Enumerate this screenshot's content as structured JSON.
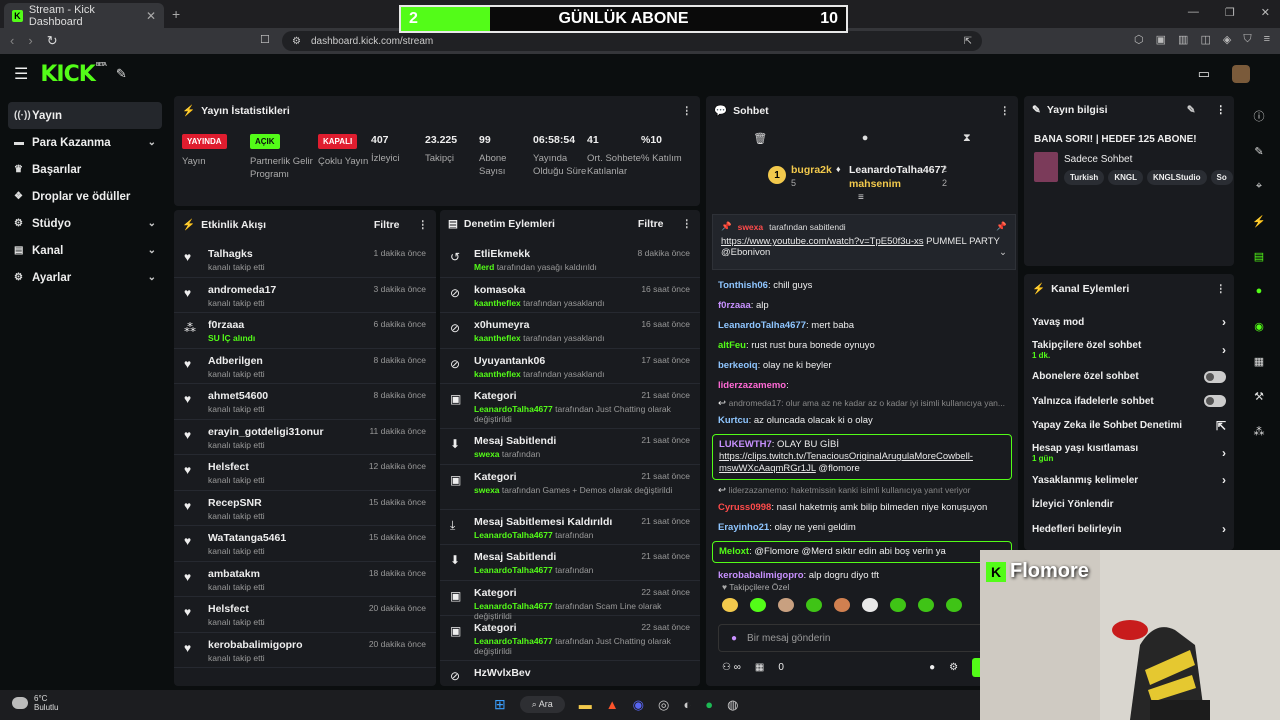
{
  "browser": {
    "tab_title": "Stream - Kick Dashboard",
    "url": "dashboard.kick.com/stream"
  },
  "overlay": {
    "left": "2",
    "title": "GÜNLÜK ABONE",
    "right": "10",
    "progress": 0.2
  },
  "sidebar": {
    "items": [
      {
        "label": "Yayın",
        "icon": "broadcast-icon",
        "chev": false,
        "active": true
      },
      {
        "label": "Para Kazanma",
        "icon": "money-icon",
        "chev": true
      },
      {
        "label": "Başarılar",
        "icon": "trophy-icon",
        "chev": false
      },
      {
        "label": "Droplar ve ödüller",
        "icon": "gift-icon",
        "chev": false
      },
      {
        "label": "Stüdyo",
        "icon": "gear-icon",
        "chev": true
      },
      {
        "label": "Kanal",
        "icon": "layout-icon",
        "chev": true
      },
      {
        "label": "Ayarlar",
        "icon": "settings-icon",
        "chev": true
      }
    ]
  },
  "stats": {
    "title": "Yayın İstatistikleri",
    "chips": [
      {
        "chip": "YAYINDA",
        "label": "Yayın",
        "color": "red"
      },
      {
        "chip": "AÇIK",
        "label": "Partnerlik Gelir Programı",
        "color": "green"
      },
      {
        "chip": "KAPALI",
        "label": "Çoklu Yayın",
        "color": "red"
      }
    ],
    "nums": [
      {
        "v": "407",
        "l": "İzleyici"
      },
      {
        "v": "23.225",
        "l": "Takipçi"
      },
      {
        "v": "99",
        "l": "Abone Sayısı"
      },
      {
        "v": "06:58:54",
        "l": "Yayında Olduğu Süre"
      },
      {
        "v": "41",
        "l": "Ort. Sohbete Katılanlar"
      },
      {
        "v": "%10",
        "l": "% Katılım"
      }
    ]
  },
  "activity": {
    "title": "Etkinlik Akışı",
    "filter": "Filtre",
    "rows": [
      {
        "name": "Talhagks",
        "sub": "kanalı takip etti",
        "time": "1 dakika önce",
        "icon": "heart-icon"
      },
      {
        "name": "andromeda17",
        "sub": "kanalı takip etti",
        "time": "3 dakika önce",
        "icon": "heart-icon"
      },
      {
        "name": "f0rzaaa",
        "sub": "SU İÇ alındı",
        "time": "6 dakika önce",
        "icon": "points-icon"
      },
      {
        "name": "Adberilgen",
        "sub": "kanalı takip etti",
        "time": "8 dakika önce",
        "icon": "heart-icon"
      },
      {
        "name": "ahmet54600",
        "sub": "kanalı takip etti",
        "time": "8 dakika önce",
        "icon": "heart-icon"
      },
      {
        "name": "erayin_gotdeligi31onur",
        "sub": "kanalı takip etti",
        "time": "11 dakika önce",
        "icon": "heart-icon"
      },
      {
        "name": "Helsfect",
        "sub": "kanalı takip etti",
        "time": "12 dakika önce",
        "icon": "heart-icon"
      },
      {
        "name": "RecepSNR",
        "sub": "kanalı takip etti",
        "time": "15 dakika önce",
        "icon": "heart-icon"
      },
      {
        "name": "WaTatanga5461",
        "sub": "kanalı takip etti",
        "time": "15 dakika önce",
        "icon": "heart-icon"
      },
      {
        "name": "ambatakm",
        "sub": "kanalı takip etti",
        "time": "18 dakika önce",
        "icon": "heart-icon"
      },
      {
        "name": "Helsfect",
        "sub": "kanalı takip etti",
        "time": "20 dakika önce",
        "icon": "heart-icon"
      },
      {
        "name": "kerobabalimigopro",
        "sub": "kanalı takip etti",
        "time": "20 dakika önce",
        "icon": "heart-icon"
      }
    ]
  },
  "mod": {
    "title": "Denetim Eylemleri",
    "filter": "Filtre",
    "rows": [
      {
        "name": "EtliEkmekk",
        "actor": "Merd",
        "sub": "tarafından yasağı kaldırıldı",
        "time": "8 dakika önce",
        "icon": "unban-icon"
      },
      {
        "name": "komasoka",
        "actor": "kaantheflex",
        "sub": "tarafından yasaklandı",
        "time": "16 saat önce",
        "icon": "ban-icon"
      },
      {
        "name": "x0humeyra",
        "actor": "kaantheflex",
        "sub": "tarafından yasaklandı",
        "time": "16 saat önce",
        "icon": "ban-icon"
      },
      {
        "name": "Uyuyantank06",
        "actor": "kaantheflex",
        "sub": "tarafından yasaklandı",
        "time": "17 saat önce",
        "icon": "ban-icon"
      },
      {
        "name": "Kategori",
        "actor": "LeanardoTalha4677",
        "sub": "tarafından Just Chatting olarak değiştirildi",
        "time": "21 saat önce",
        "icon": "category-icon"
      },
      {
        "name": "Mesaj Sabitlendi",
        "actor": "swexa",
        "sub": "tarafından",
        "time": "21 saat önce",
        "icon": "pin-icon"
      },
      {
        "name": "Kategori",
        "actor": "swexa",
        "sub": "tarafından Games + Demos olarak değiştirildi",
        "time": "21 saat önce",
        "icon": "category-icon"
      },
      {
        "name": "Mesaj Sabitlemesi Kaldırıldı",
        "actor": "LeanardoTalha4677",
        "sub": "tarafından",
        "time": "21 saat önce",
        "icon": "unpin-icon"
      },
      {
        "name": "Mesaj Sabitlendi",
        "actor": "LeanardoTalha4677",
        "sub": "tarafından",
        "time": "21 saat önce",
        "icon": "pin-icon"
      },
      {
        "name": "Kategori",
        "actor": "LeanardoTalha4677",
        "sub": "tarafından Scam Line olarak değiştirildi",
        "time": "22 saat önce",
        "icon": "category-icon"
      },
      {
        "name": "Kategori",
        "actor": "LeanardoTalha4677",
        "sub": "tarafından Just Chatting olarak değiştirildi",
        "time": "22 saat önce",
        "icon": "category-icon"
      },
      {
        "name": "HzWvlxBev",
        "actor": "",
        "sub": "",
        "time": "",
        "icon": "ban-icon"
      }
    ]
  },
  "chat": {
    "title": "Sohbet",
    "leaders": [
      {
        "name": "bugra2k",
        "count": "5",
        "rank": "1"
      },
      {
        "name": "LeanardoTalha4677",
        "count": "2"
      },
      {
        "name": "mahsenim",
        "count": "2"
      }
    ],
    "pinned": {
      "by": "swexa",
      "label": "tarafından sabitlendi",
      "text": "https://www.youtube.com/watch?v=TpE50f3u-xs",
      "rest": " PUMMEL PARTY @Ebonivon"
    },
    "messages": [
      {
        "u": "Tonthish06",
        "c": "#8fc6ff",
        "t": ": chill guys"
      },
      {
        "u": "f0rzaaa",
        "c": "#c891ff",
        "t": ": alp"
      },
      {
        "u": "LeanardoTalha4677",
        "c": "#8fc6ff",
        "t": ": mert baba"
      },
      {
        "u": "altFeu",
        "c": "#53fc18",
        "t": ": rust rust bura bonede oynuyo"
      },
      {
        "u": "berkeoiq",
        "c": "#8fc6ff",
        "t": ": olay ne ki beyler"
      },
      {
        "u": "liderzazamemo",
        "c": "#ff6ad5",
        "t": ":"
      },
      {
        "reply": "andromeda17: olur ama az ne kadar az o kadar iyi isimli kullanıcıya yan..."
      },
      {
        "u": "Kurtcu",
        "c": "#8fc6ff",
        "t": ": az oluncada olacak ki o olay"
      },
      {
        "u": "LUKEWTH7",
        "c": "#c891ff",
        "t": ": OLAY BU GİBİ",
        "link": "https://clips.twitch.tv/TenaciousOriginalArugulaMoreCowbell-mswWXcAaqmRGr1JL",
        "mention": " @flomore",
        "hl": true
      },
      {
        "reply": "liderzazamemo: haketmissin kanki isimli kullanıcıya yanıt veriyor"
      },
      {
        "u": "Cyruss0998",
        "c": "#ff4b4b",
        "t": ": nasıl haketmiş amk bilip bilmeden niye konuşuyon"
      },
      {
        "u": "Erayinho21",
        "c": "#8fc6ff",
        "t": ": olay ne yeni geldim"
      },
      {
        "u": "Meloxt",
        "c": "#53fc18",
        "t": ": @Flomore @Merd sıktır edin abi boş verin ya",
        "hl": true
      },
      {
        "u": "kerobabalimigopro",
        "c": "#c891ff",
        "t": ": alp dogru diyo tft"
      }
    ],
    "followers_only": "Takipçilere Özel",
    "placeholder": "Bir mesaj gönderin",
    "send": "Gö",
    "points": "0"
  },
  "info": {
    "title": "Yayın bilgisi",
    "stream_title": "BANA SORI! | HEDEF 125 ABONE!",
    "category": "Sadece Sohbet",
    "tags": [
      "Turkish",
      "KNGL",
      "KNGLStudio",
      "So"
    ]
  },
  "actions": {
    "title": "Kanal Eylemleri",
    "rows": [
      {
        "label": "Yavaş mod",
        "type": "chev"
      },
      {
        "label": "Takipçilere özel sohbet",
        "sub": "1 dk.",
        "type": "chev"
      },
      {
        "label": "Abonelere özel sohbet",
        "type": "toggle"
      },
      {
        "label": "Yalnızca ifadelerle sohbet",
        "type": "toggle"
      },
      {
        "label": "Yapay Zeka ile Sohbet Denetimi",
        "type": "ext"
      },
      {
        "label": "Hesap yaşı kısıtlaması",
        "sub": "1 gün",
        "type": "chev"
      },
      {
        "label": "Yasaklanmış kelimeler",
        "type": "chev"
      },
      {
        "label": "İzleyici Yönlendir",
        "type": "none"
      },
      {
        "label": "Hedefleri belirleyin",
        "type": "chev"
      }
    ]
  },
  "webcam": {
    "name": "Flomore"
  },
  "taskbar": {
    "temp": "6°C",
    "weather": "Bulutlu",
    "search": "Ara",
    "badge": "4"
  },
  "colors": {
    "accent": "#53fc18",
    "panel": "#191b1f",
    "bg": "#0b0e0f",
    "live": "#e01d2f"
  }
}
